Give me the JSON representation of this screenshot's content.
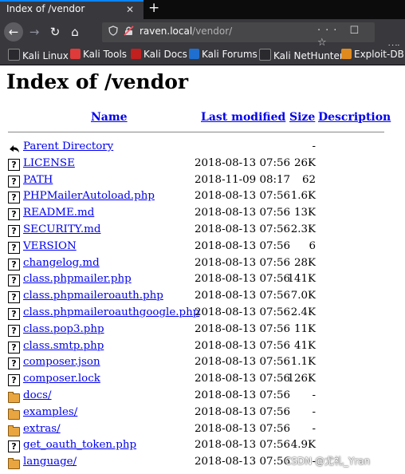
{
  "browser": {
    "tab_title": "Index of /vendor",
    "tab_close": "✕",
    "new_tab": "+",
    "nav_back": "←",
    "nav_forward": "→",
    "nav_reload": "↻",
    "nav_home": "⌂",
    "url_host": "raven.local",
    "url_path": "/vendor/",
    "url_actions": "··· ☐ ☆",
    "library_icon": "|||\\",
    "bookmarks": [
      {
        "label": "Kali Linux",
        "color": "#2a2a2e"
      },
      {
        "label": "Kali Tools",
        "color": "#e03a3a"
      },
      {
        "label": "Kali Docs",
        "color": "#c21f1f"
      },
      {
        "label": "Kali Forums",
        "color": "#1f6fd1"
      },
      {
        "label": "Kali NetHunter",
        "color": "#2a2a2e"
      },
      {
        "label": "Exploit-DB",
        "color": "#e08a1e"
      }
    ]
  },
  "page": {
    "title": "Index of /vendor",
    "columns": {
      "name": "Name",
      "last_modified": "Last modified",
      "size": "Size",
      "description": "Description"
    },
    "rows": [
      {
        "name": "Parent Directory",
        "modified": "",
        "size": "-",
        "type": "parent"
      },
      {
        "name": "LICENSE",
        "modified": "2018-08-13 07:56",
        "size": "26K",
        "type": "file"
      },
      {
        "name": "PATH",
        "modified": "2018-11-09 08:17",
        "size": "62",
        "type": "file"
      },
      {
        "name": "PHPMailerAutoload.php",
        "modified": "2018-08-13 07:56",
        "size": "1.6K",
        "type": "file"
      },
      {
        "name": "README.md",
        "modified": "2018-08-13 07:56",
        "size": "13K",
        "type": "file"
      },
      {
        "name": "SECURITY.md",
        "modified": "2018-08-13 07:56",
        "size": "2.3K",
        "type": "file"
      },
      {
        "name": "VERSION",
        "modified": "2018-08-13 07:56",
        "size": "6",
        "type": "file"
      },
      {
        "name": "changelog.md",
        "modified": "2018-08-13 07:56",
        "size": "28K",
        "type": "file"
      },
      {
        "name": "class.phpmailer.php",
        "modified": "2018-08-13 07:56",
        "size": "141K",
        "type": "file"
      },
      {
        "name": "class.phpmaileroauth.php",
        "modified": "2018-08-13 07:56",
        "size": "7.0K",
        "type": "file"
      },
      {
        "name": "class.phpmaileroauthgoogle.php",
        "modified": "2018-08-13 07:56",
        "size": "2.4K",
        "type": "file"
      },
      {
        "name": "class.pop3.php",
        "modified": "2018-08-13 07:56",
        "size": "11K",
        "type": "file"
      },
      {
        "name": "class.smtp.php",
        "modified": "2018-08-13 07:56",
        "size": "41K",
        "type": "file"
      },
      {
        "name": "composer.json",
        "modified": "2018-08-13 07:56",
        "size": "1.1K",
        "type": "file"
      },
      {
        "name": "composer.lock",
        "modified": "2018-08-13 07:56",
        "size": "126K",
        "type": "file"
      },
      {
        "name": "docs/",
        "modified": "2018-08-13 07:56",
        "size": "-",
        "type": "folder"
      },
      {
        "name": "examples/",
        "modified": "2018-08-13 07:56",
        "size": "-",
        "type": "folder"
      },
      {
        "name": "extras/",
        "modified": "2018-08-13 07:56",
        "size": "-",
        "type": "folder"
      },
      {
        "name": "get_oauth_token.php",
        "modified": "2018-08-13 07:56",
        "size": "4.9K",
        "type": "file"
      },
      {
        "name": "language/",
        "modified": "2018-08-13 07:56",
        "size": "-",
        "type": "folder"
      }
    ],
    "file_icon_glyph": "?"
  },
  "watermark": "CSDN @尤礼_Yran"
}
